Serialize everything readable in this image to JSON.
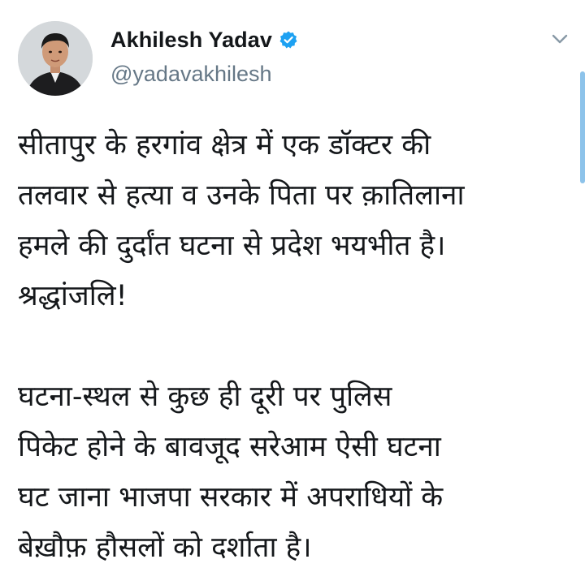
{
  "author": {
    "display_name": "Akhilesh Yadav",
    "handle": "@yadavakhilesh",
    "verified": true
  },
  "icons": {
    "verified": "verified-badge-icon",
    "menu": "chevron-down-icon",
    "avatar": "profile-photo"
  },
  "colors": {
    "text": "#14171a",
    "handle": "#657786",
    "verified_badge": "#1da1f2",
    "scrollbar": "#8dc3ea"
  },
  "tweet": {
    "paragraph1": [
      "सीतापुर के हरगांव क्षेत्र में एक डॉक्टर की",
      "तलवार से हत्या व उनके पिता पर क़ातिलाना",
      "हमले की दुर्दांत घटना से प्रदेश भयभीत है।",
      "श्रद्धांजलि!"
    ],
    "paragraph2": [
      "घटना-स्थल से कुछ ही दूरी पर पुलिस",
      "पिकेट होने के बावजूद सरेआम ऐसी घटना",
      "घट जाना भाजपा सरकार में अपराधियों के",
      "बेख़ौफ़ हौसलों को दर्शाता है।"
    ]
  }
}
